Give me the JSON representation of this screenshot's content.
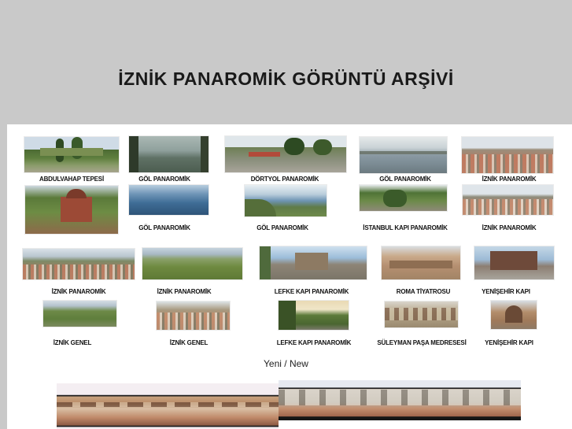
{
  "page": {
    "title": "İZNİK PANAROMİK GÖRÜNTÜ ARŞİVİ"
  },
  "gallery": {
    "row1": [
      {
        "caption": "ABDULVAHAP TEPESİ"
      },
      {
        "caption": "GÖL PANAROMİK"
      },
      {
        "caption": "DÖRTYOL PANAROMİK"
      },
      {
        "caption": "GÖL PANAROMİK"
      },
      {
        "caption": "İZNİK PANAROMİK"
      }
    ],
    "row2": [
      {
        "caption": ""
      },
      {
        "caption": "GÖL PANAROMİK"
      },
      {
        "caption": "GÖL PANAROMİK"
      },
      {
        "caption": "İSTANBUL KAPI PANAROMİK"
      },
      {
        "caption": "İZNİK PANAROMİK"
      }
    ],
    "row3": [
      {
        "caption": "İZNİK PANAROMİK"
      },
      {
        "caption": "İZNİK PANAROMİK"
      },
      {
        "caption": "LEFKE KAPI PANAROMİK"
      },
      {
        "caption": "ROMA TİYATROSU"
      },
      {
        "caption": "YENİŞEHİR KAPI"
      }
    ],
    "row4": [
      {
        "caption": "İZNİK GENEL"
      },
      {
        "caption": "İZNİK GENEL"
      },
      {
        "caption": "LEFKE KAPI PANAROMİK"
      },
      {
        "caption": "SÜLEYMAN PAŞA MEDRESESİ"
      },
      {
        "caption": "YENİŞEHİR KAPI"
      }
    ]
  },
  "new_section": {
    "label": "Yeni / New"
  }
}
